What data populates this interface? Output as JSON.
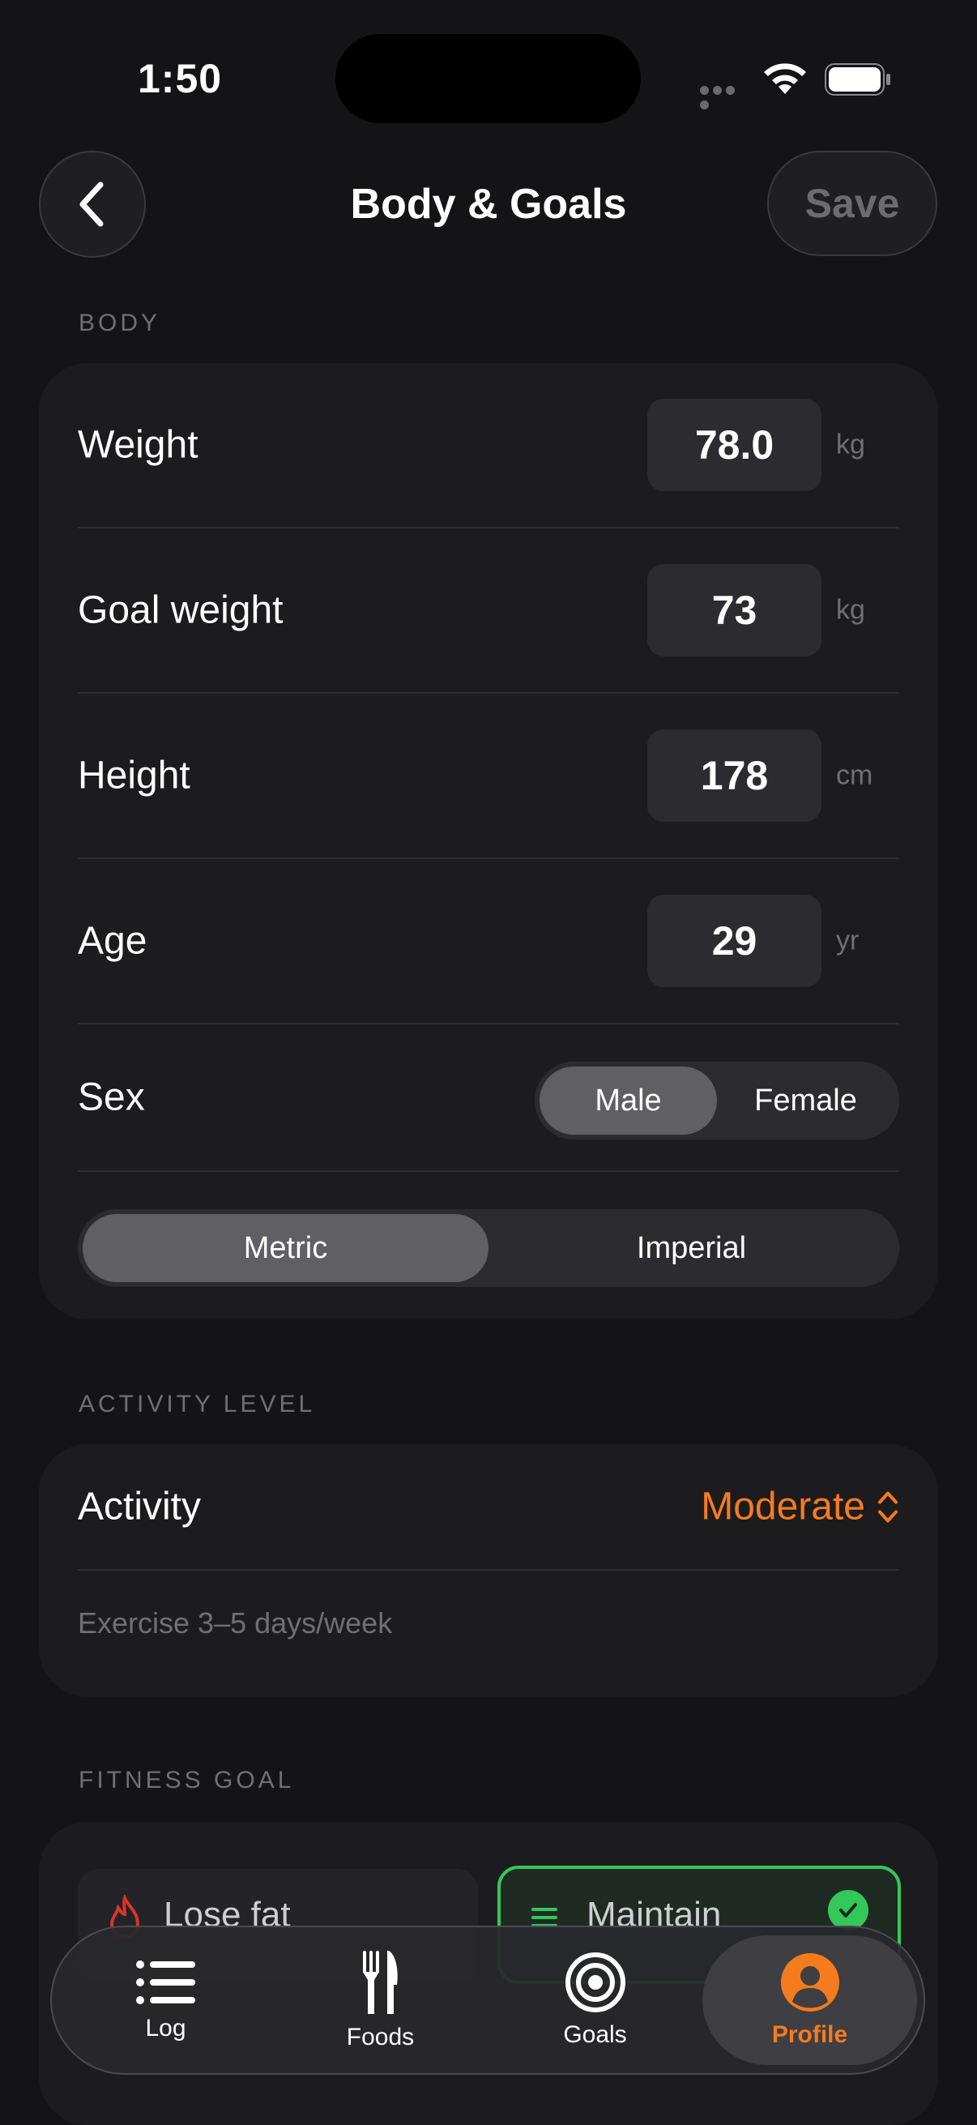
{
  "status_bar": {
    "time": "1:50"
  },
  "header": {
    "title": "Body & Goals",
    "save_label": "Save"
  },
  "body_section": {
    "label": "BODY",
    "rows": [
      {
        "label": "Weight",
        "value": "78.0",
        "unit": "kg"
      },
      {
        "label": "Goal weight",
        "value": "73",
        "unit": "kg"
      },
      {
        "label": "Height",
        "value": "178",
        "unit": "cm"
      },
      {
        "label": "Age",
        "value": "29",
        "unit": "yr"
      }
    ],
    "sex": {
      "label": "Sex",
      "options": [
        "Male",
        "Female"
      ],
      "selected": "Male"
    },
    "units": {
      "options": [
        "Metric",
        "Imperial"
      ],
      "selected": "Metric"
    }
  },
  "activity_section": {
    "label": "ACTIVITY LEVEL",
    "row_label": "Activity",
    "value": "Moderate",
    "description": "Exercise 3–5 days/week"
  },
  "fitness_section": {
    "label": "FITNESS GOAL",
    "options": [
      {
        "label": "Lose fat",
        "icon": "flame-icon",
        "selected": false
      },
      {
        "label": "Maintain",
        "icon": "equals-icon",
        "selected": true
      }
    ]
  },
  "tab_bar": {
    "tabs": [
      {
        "label": "Log",
        "icon": "list-icon"
      },
      {
        "label": "Foods",
        "icon": "fork-knife-icon"
      },
      {
        "label": "Goals",
        "icon": "target-icon"
      },
      {
        "label": "Profile",
        "icon": "person-icon"
      }
    ],
    "active": "Profile"
  },
  "colors": {
    "accent": "#F57B1F",
    "success": "#34C759",
    "background": "#141417",
    "card": "#1C1C1F"
  }
}
